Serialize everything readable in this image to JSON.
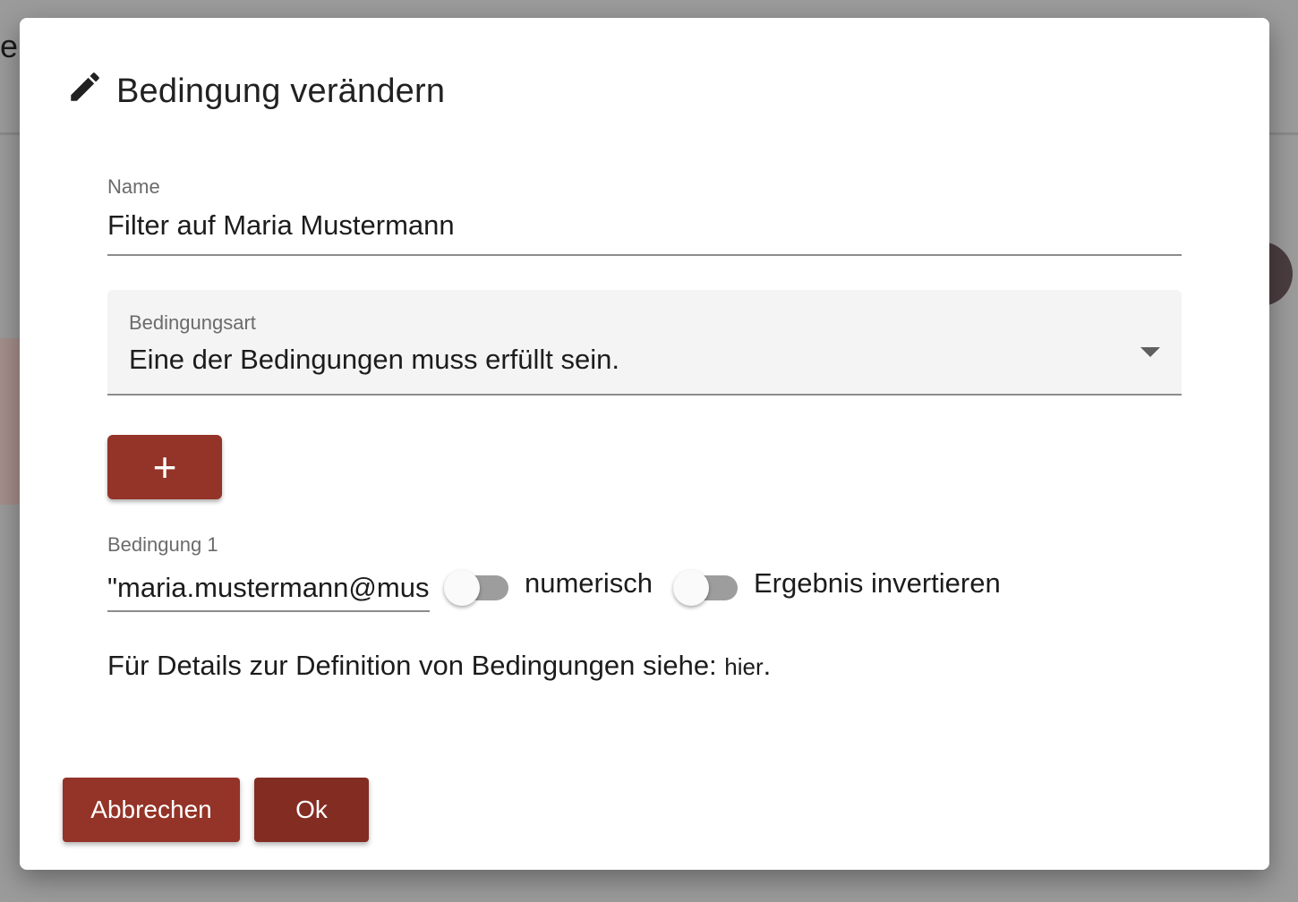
{
  "background": {
    "partial_text": "er"
  },
  "dialog": {
    "title": "Bedingung verändern",
    "title_icon": "pencil-icon"
  },
  "name_field": {
    "label": "Name",
    "value": "Filter auf Maria Mustermann"
  },
  "condition_type": {
    "label": "Bedingungsart",
    "selected": "Eine der Bedingungen muss erfüllt sein.",
    "arrow_icon": "dropdown-arrow-icon"
  },
  "add_button": {
    "label": "+"
  },
  "condition_1": {
    "label": "Bedingung 1",
    "value": "\"maria.mustermann@mustermann.de\"",
    "numeric_toggle_label": "numerisch",
    "numeric_on": false,
    "invert_toggle_label": "Ergebnis invertieren",
    "invert_on": false
  },
  "help": {
    "text": "Für Details zur Definition von Bedingungen siehe: ",
    "link": "hier",
    "suffix": "."
  },
  "footer": {
    "cancel_label": "Abbrechen",
    "ok_label": "Ok"
  },
  "colors": {
    "primary": "#943327",
    "primary_dark": "#832c22",
    "overlay": "#9b9b9b"
  }
}
